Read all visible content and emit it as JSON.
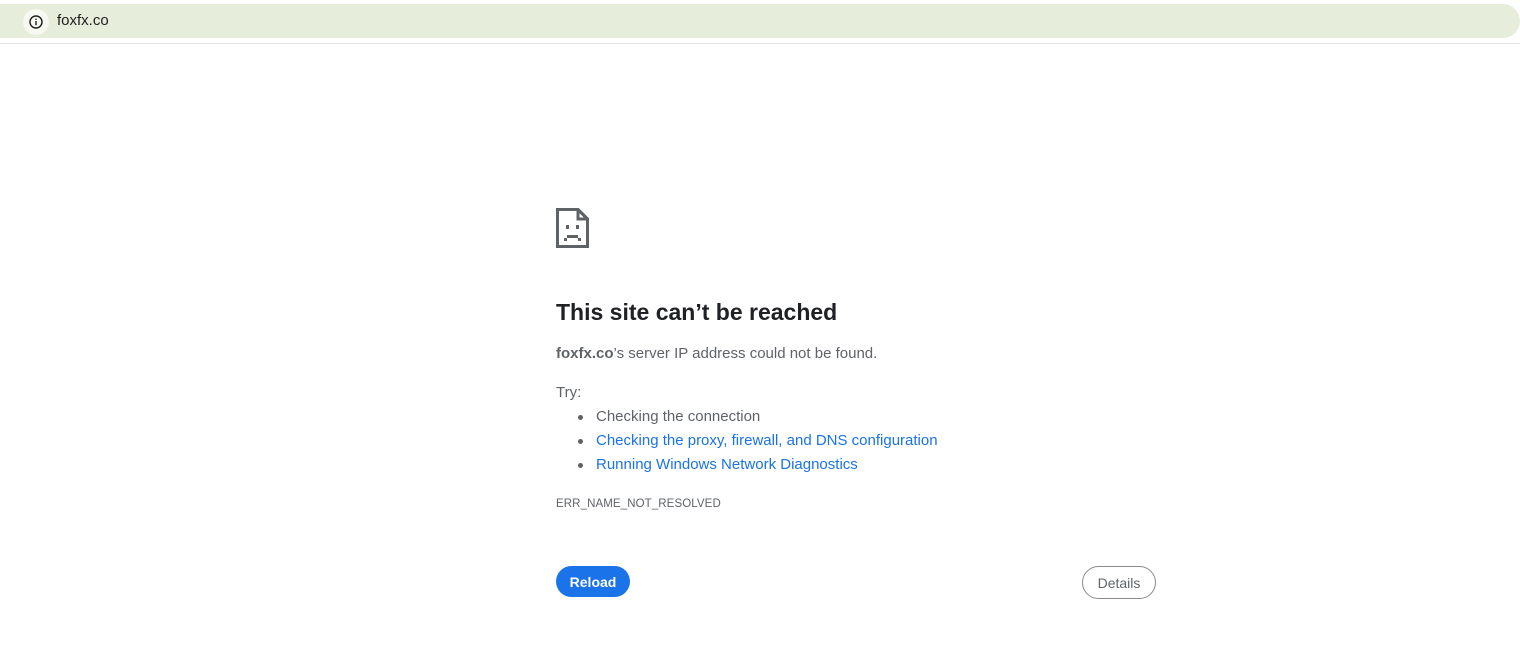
{
  "omnibox": {
    "url": "foxfx.co",
    "info_icon": "info-circle-icon"
  },
  "error_page": {
    "icon": "sad-page-icon",
    "heading": "This site can’t be reached",
    "summary_host": "foxfx.co",
    "summary_rest": "’s server IP address could not be found.",
    "try_label": "Try:",
    "suggestions": [
      {
        "text": "Checking the connection",
        "link": false
      },
      {
        "text": "Checking the proxy, firewall, and DNS configuration",
        "link": true
      },
      {
        "text": "Running Windows Network Diagnostics",
        "link": true
      }
    ],
    "error_code": "ERR_NAME_NOT_RESOLVED",
    "reload_label": "Reload",
    "details_label": "Details"
  },
  "colors": {
    "omnibox_bg": "#e6eddb",
    "link": "#1a73e8",
    "primary_button": "#1a73e8",
    "heading": "#202124",
    "body_text": "#5f6368"
  }
}
